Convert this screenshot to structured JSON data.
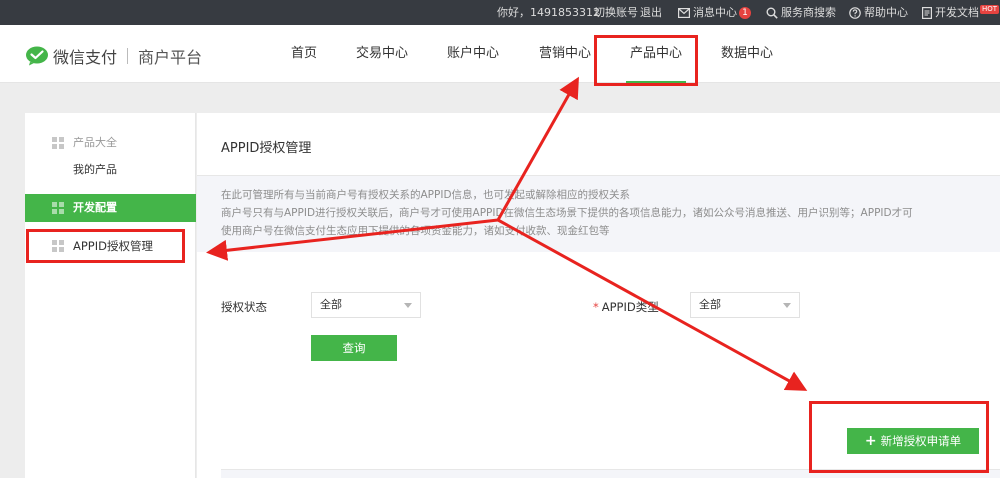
{
  "topbar": {
    "greeting": "你好，1491853312",
    "switch_account": "切换账号",
    "logout": "退出",
    "messages": "消息中心",
    "message_count": "1",
    "search_provider": "服务商搜索",
    "help": "帮助中心",
    "dev_docs": "开发文档",
    "hot_badge": "HOT"
  },
  "header": {
    "logo_text": "微信支付",
    "platform": "商户平台",
    "nav": [
      "首页",
      "交易中心",
      "账户中心",
      "营销中心",
      "产品中心",
      "数据中心"
    ],
    "active_nav": "产品中心"
  },
  "sidebar": {
    "group1_title": "产品大全",
    "group1_item": "我的产品",
    "group2_title": "开发配置",
    "group2_item": "APPID授权管理"
  },
  "main": {
    "title": "APPID授权管理",
    "info_lines": [
      "在此可管理所有与当前商户号有授权关系的APPID信息，也可发起或解除相应的授权关系",
      "商户号只有与APPID进行授权关联后，商户号才可使用APPID在微信生态场景下提供的各项信息能力，诸如公众号消息推送、用户识别等；APPID才可",
      "使用商户号在微信支付生态应用下提供的各项资金能力，诸如支付收款、现金红包等"
    ],
    "auth_status_label": "授权状态",
    "auth_status_value": "全部",
    "appid_type_required": "*",
    "appid_type_label": "APPID类型",
    "appid_type_value": "全部",
    "query_button": "查询",
    "new_request_button": "新增授权申请单",
    "plus_glyph": "+"
  },
  "colors": {
    "brand_green": "#44b549",
    "topbar_bg": "#373b41",
    "annotation_red": "#e8231f"
  },
  "icons": {
    "logo": "wechat-pay-logo",
    "messages": "mail-icon",
    "search": "search-icon",
    "help": "help-icon",
    "docs": "document-icon",
    "sidebar": "grid-icon"
  }
}
